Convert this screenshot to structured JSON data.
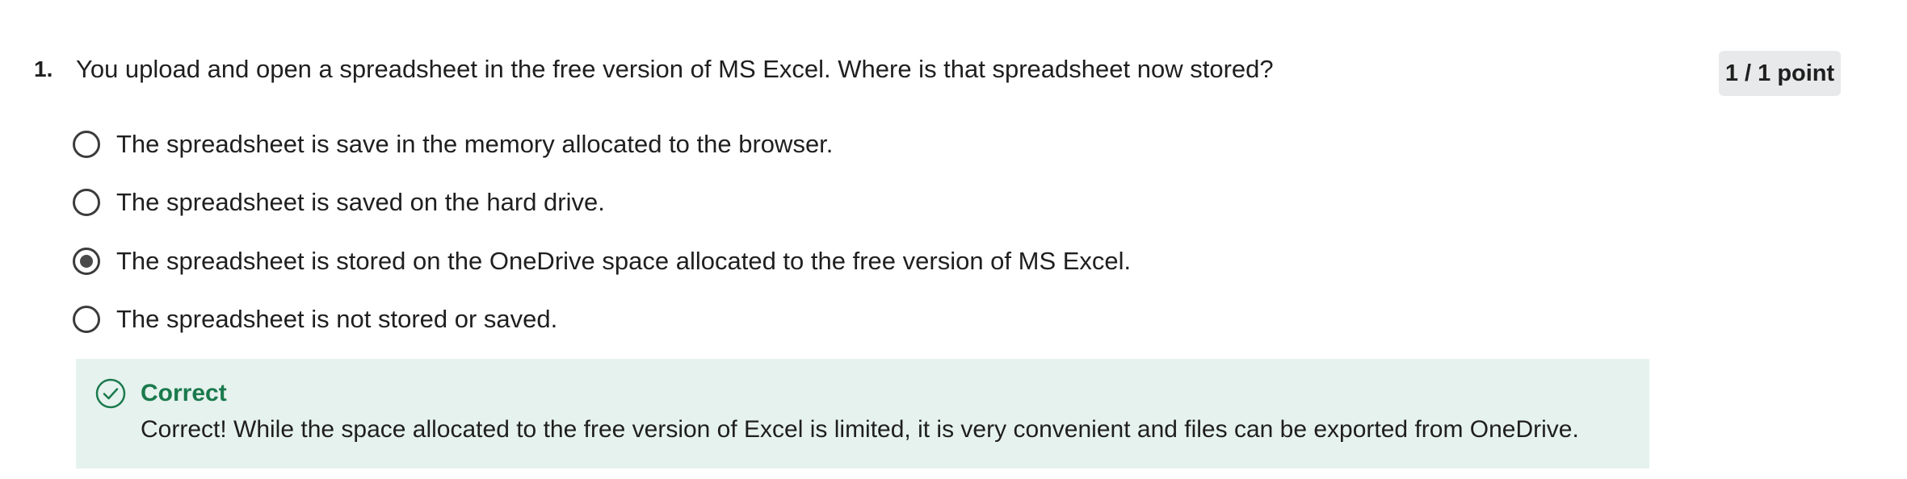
{
  "question": {
    "number": "1.",
    "text": "You upload and open a spreadsheet in the free version of MS Excel. Where is that spreadsheet now stored?",
    "points": "1 / 1 point"
  },
  "options": [
    {
      "label": "The spreadsheet is save in the memory allocated to the browser.",
      "selected": false
    },
    {
      "label": "The spreadsheet is saved on the hard drive.",
      "selected": false
    },
    {
      "label": "The spreadsheet is stored on the OneDrive space allocated to the free version of MS Excel.",
      "selected": true
    },
    {
      "label": "The spreadsheet is not stored or saved.",
      "selected": false
    }
  ],
  "feedback": {
    "icon": "check-circle-icon",
    "title": "Correct",
    "text": "Correct! While the space allocated to the free version of Excel is limited, it is very convenient and files can be exported from OneDrive.",
    "accent_color": "#1b7a4d",
    "background_color": "#e6f2ee"
  }
}
